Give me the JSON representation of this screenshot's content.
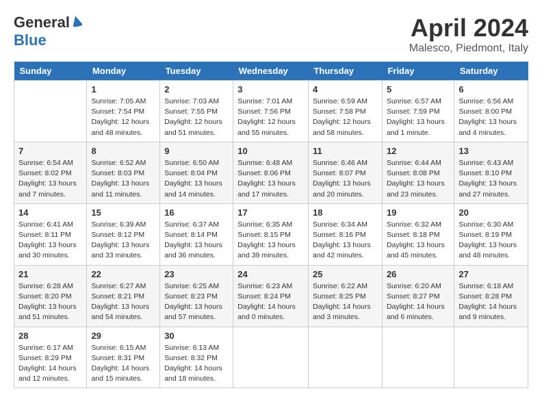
{
  "header": {
    "logo_general": "General",
    "logo_blue": "Blue",
    "title": "April 2024",
    "location": "Malesco, Piedmont, Italy"
  },
  "weekdays": [
    "Sunday",
    "Monday",
    "Tuesday",
    "Wednesday",
    "Thursday",
    "Friday",
    "Saturday"
  ],
  "weeks": [
    [
      {
        "day": "",
        "sunrise": "",
        "sunset": "",
        "daylight": ""
      },
      {
        "day": "1",
        "sunrise": "Sunrise: 7:05 AM",
        "sunset": "Sunset: 7:54 PM",
        "daylight": "Daylight: 12 hours and 48 minutes."
      },
      {
        "day": "2",
        "sunrise": "Sunrise: 7:03 AM",
        "sunset": "Sunset: 7:55 PM",
        "daylight": "Daylight: 12 hours and 51 minutes."
      },
      {
        "day": "3",
        "sunrise": "Sunrise: 7:01 AM",
        "sunset": "Sunset: 7:56 PM",
        "daylight": "Daylight: 12 hours and 55 minutes."
      },
      {
        "day": "4",
        "sunrise": "Sunrise: 6:59 AM",
        "sunset": "Sunset: 7:58 PM",
        "daylight": "Daylight: 12 hours and 58 minutes."
      },
      {
        "day": "5",
        "sunrise": "Sunrise: 6:57 AM",
        "sunset": "Sunset: 7:59 PM",
        "daylight": "Daylight: 13 hours and 1 minute."
      },
      {
        "day": "6",
        "sunrise": "Sunrise: 6:56 AM",
        "sunset": "Sunset: 8:00 PM",
        "daylight": "Daylight: 13 hours and 4 minutes."
      }
    ],
    [
      {
        "day": "7",
        "sunrise": "Sunrise: 6:54 AM",
        "sunset": "Sunset: 8:02 PM",
        "daylight": "Daylight: 13 hours and 7 minutes."
      },
      {
        "day": "8",
        "sunrise": "Sunrise: 6:52 AM",
        "sunset": "Sunset: 8:03 PM",
        "daylight": "Daylight: 13 hours and 11 minutes."
      },
      {
        "day": "9",
        "sunrise": "Sunrise: 6:50 AM",
        "sunset": "Sunset: 8:04 PM",
        "daylight": "Daylight: 13 hours and 14 minutes."
      },
      {
        "day": "10",
        "sunrise": "Sunrise: 6:48 AM",
        "sunset": "Sunset: 8:06 PM",
        "daylight": "Daylight: 13 hours and 17 minutes."
      },
      {
        "day": "11",
        "sunrise": "Sunrise: 6:46 AM",
        "sunset": "Sunset: 8:07 PM",
        "daylight": "Daylight: 13 hours and 20 minutes."
      },
      {
        "day": "12",
        "sunrise": "Sunrise: 6:44 AM",
        "sunset": "Sunset: 8:08 PM",
        "daylight": "Daylight: 13 hours and 23 minutes."
      },
      {
        "day": "13",
        "sunrise": "Sunrise: 6:43 AM",
        "sunset": "Sunset: 8:10 PM",
        "daylight": "Daylight: 13 hours and 27 minutes."
      }
    ],
    [
      {
        "day": "14",
        "sunrise": "Sunrise: 6:41 AM",
        "sunset": "Sunset: 8:11 PM",
        "daylight": "Daylight: 13 hours and 30 minutes."
      },
      {
        "day": "15",
        "sunrise": "Sunrise: 6:39 AM",
        "sunset": "Sunset: 8:12 PM",
        "daylight": "Daylight: 13 hours and 33 minutes."
      },
      {
        "day": "16",
        "sunrise": "Sunrise: 6:37 AM",
        "sunset": "Sunset: 8:14 PM",
        "daylight": "Daylight: 13 hours and 36 minutes."
      },
      {
        "day": "17",
        "sunrise": "Sunrise: 6:35 AM",
        "sunset": "Sunset: 8:15 PM",
        "daylight": "Daylight: 13 hours and 39 minutes."
      },
      {
        "day": "18",
        "sunrise": "Sunrise: 6:34 AM",
        "sunset": "Sunset: 8:16 PM",
        "daylight": "Daylight: 13 hours and 42 minutes."
      },
      {
        "day": "19",
        "sunrise": "Sunrise: 6:32 AM",
        "sunset": "Sunset: 8:18 PM",
        "daylight": "Daylight: 13 hours and 45 minutes."
      },
      {
        "day": "20",
        "sunrise": "Sunrise: 6:30 AM",
        "sunset": "Sunset: 8:19 PM",
        "daylight": "Daylight: 13 hours and 48 minutes."
      }
    ],
    [
      {
        "day": "21",
        "sunrise": "Sunrise: 6:28 AM",
        "sunset": "Sunset: 8:20 PM",
        "daylight": "Daylight: 13 hours and 51 minutes."
      },
      {
        "day": "22",
        "sunrise": "Sunrise: 6:27 AM",
        "sunset": "Sunset: 8:21 PM",
        "daylight": "Daylight: 13 hours and 54 minutes."
      },
      {
        "day": "23",
        "sunrise": "Sunrise: 6:25 AM",
        "sunset": "Sunset: 8:23 PM",
        "daylight": "Daylight: 13 hours and 57 minutes."
      },
      {
        "day": "24",
        "sunrise": "Sunrise: 6:23 AM",
        "sunset": "Sunset: 8:24 PM",
        "daylight": "Daylight: 14 hours and 0 minutes."
      },
      {
        "day": "25",
        "sunrise": "Sunrise: 6:22 AM",
        "sunset": "Sunset: 8:25 PM",
        "daylight": "Daylight: 14 hours and 3 minutes."
      },
      {
        "day": "26",
        "sunrise": "Sunrise: 6:20 AM",
        "sunset": "Sunset: 8:27 PM",
        "daylight": "Daylight: 14 hours and 6 minutes."
      },
      {
        "day": "27",
        "sunrise": "Sunrise: 6:18 AM",
        "sunset": "Sunset: 8:28 PM",
        "daylight": "Daylight: 14 hours and 9 minutes."
      }
    ],
    [
      {
        "day": "28",
        "sunrise": "Sunrise: 6:17 AM",
        "sunset": "Sunset: 8:29 PM",
        "daylight": "Daylight: 14 hours and 12 minutes."
      },
      {
        "day": "29",
        "sunrise": "Sunrise: 6:15 AM",
        "sunset": "Sunset: 8:31 PM",
        "daylight": "Daylight: 14 hours and 15 minutes."
      },
      {
        "day": "30",
        "sunrise": "Sunrise: 6:13 AM",
        "sunset": "Sunset: 8:32 PM",
        "daylight": "Daylight: 14 hours and 18 minutes."
      },
      {
        "day": "",
        "sunrise": "",
        "sunset": "",
        "daylight": ""
      },
      {
        "day": "",
        "sunrise": "",
        "sunset": "",
        "daylight": ""
      },
      {
        "day": "",
        "sunrise": "",
        "sunset": "",
        "daylight": ""
      },
      {
        "day": "",
        "sunrise": "",
        "sunset": "",
        "daylight": ""
      }
    ]
  ]
}
